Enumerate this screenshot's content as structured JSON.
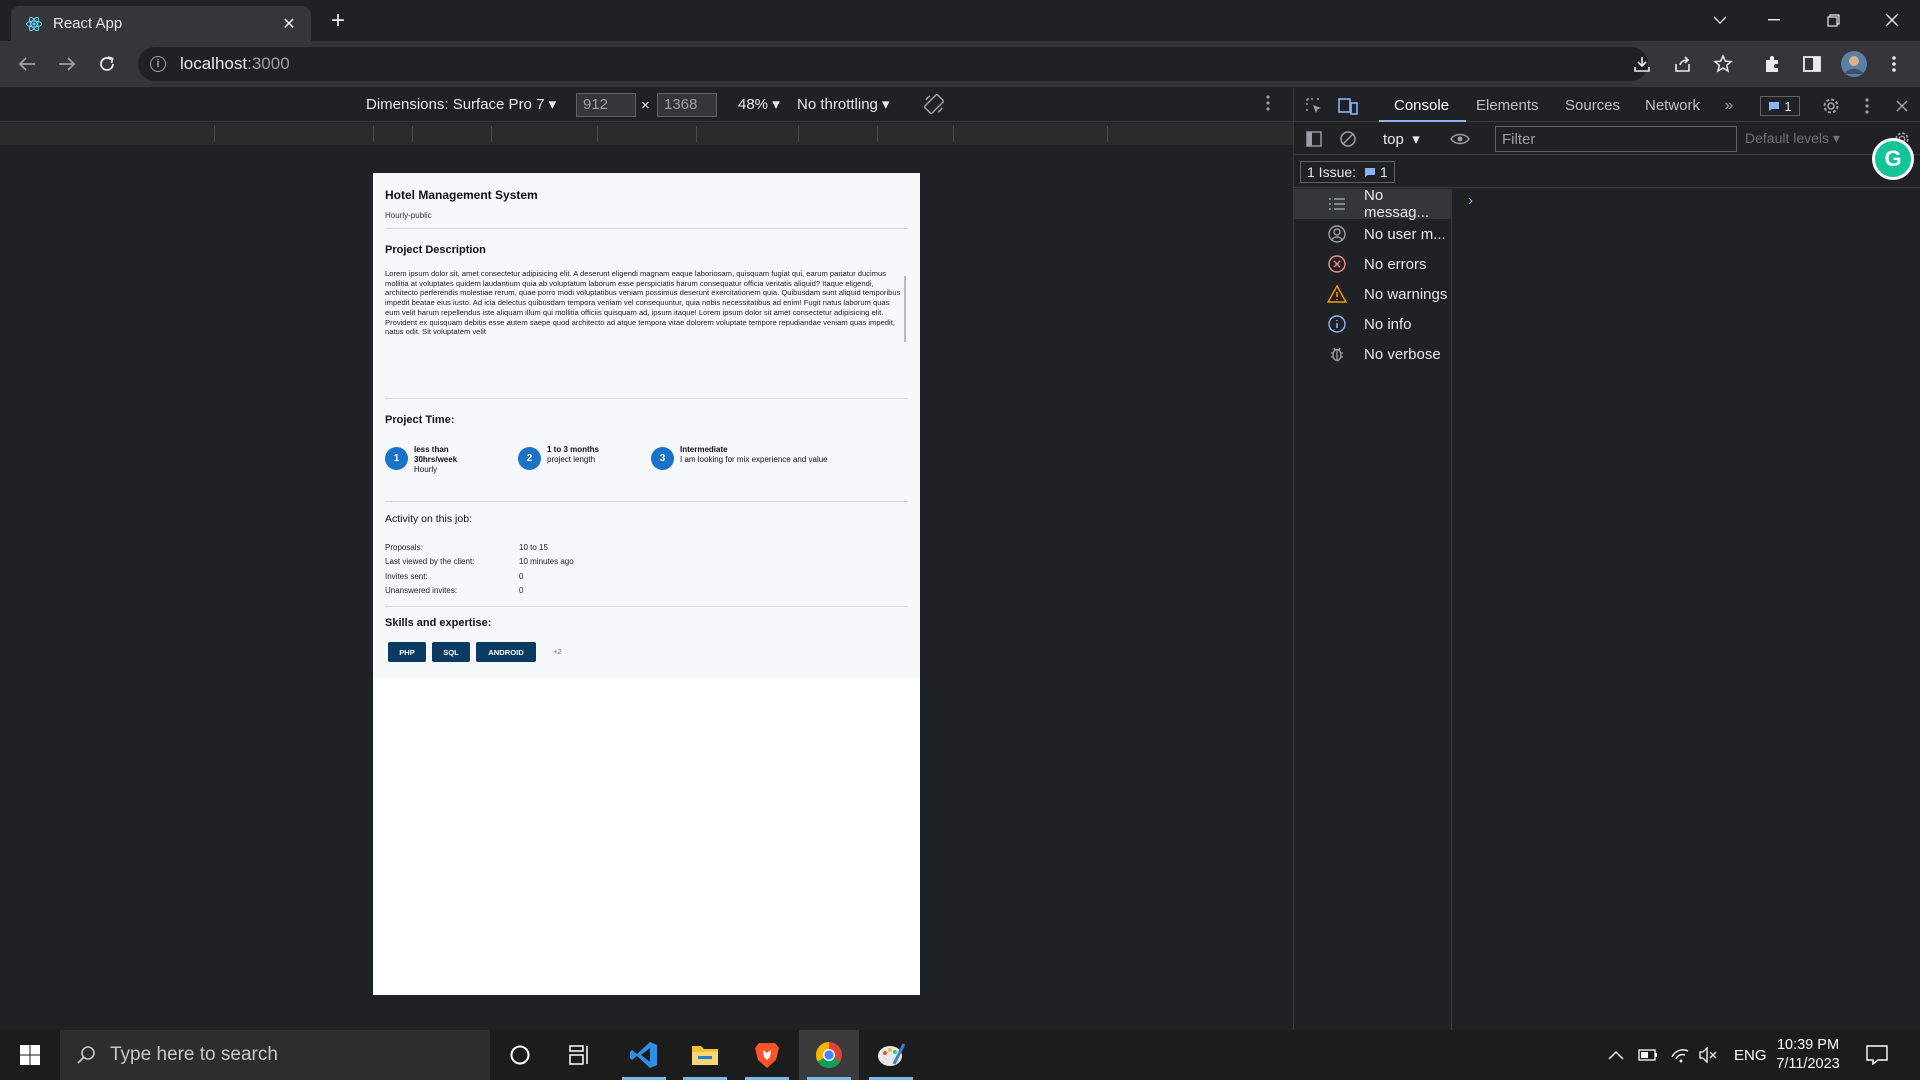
{
  "browser": {
    "tab_title": "React App",
    "url_host": "localhost",
    "url_port": ":3000"
  },
  "device_toolbar": {
    "dimensions_label": "Dimensions: Surface Pro 7",
    "width_value": "912",
    "times": "×",
    "height_value": "1368",
    "zoom": "48%",
    "throttling": "No throttling"
  },
  "page": {
    "title": "Hotel Management System",
    "subtitle": "Hourly-public",
    "description_heading": "Project Description",
    "description": "Lorem ipsum dolor sit, amet consectetur adipisicing elit. A deserunt eligendi magnam eaque laboriosam, quisquam fugiat qui, earum pariatur ducimus mollitia at voluptates quidem laudantium quia ab voluptatum laborum esse perspiciatis harum consequatur officia veritatis aliquid? Itaque eligendi, architecto perferendis molestiae rerum, quae porro modi voluptatibus veniam possimus deserunt exercitationem quia. Quibusdam sunt aliquid temporibus impedit beatae eius iusto. Ad icia delectus quibusdam tempora veniam vel consequuntur, quia nobis necessitatibus ad enim! Fugit natus laborum quas eum velit harum repellendus iste aliquam illum qui mollitia officiis quisquam ad, ipsum itaque! Lorem ipsum dolor sit amet consectetur adipisicing elit. Provident ex quisquam debitis esse autem saepe quod architecto ad atque tempora vitae dolorem voluptate tempore repudiandae veniam quas impedit, natus odit. Sit voluptatem velit",
    "time_heading": "Project Time:",
    "steps": [
      {
        "num": "1",
        "title": "less than 30hrs/week",
        "detail": "Hourly"
      },
      {
        "num": "2",
        "title": "1 to 3 months",
        "detail": "project length"
      },
      {
        "num": "3",
        "title": "Intermediate",
        "detail": "I am looking for mix experience and value"
      }
    ],
    "activity_heading": "Activity on this job:",
    "activity": [
      {
        "label": "Proposals:",
        "value": "10 to 15"
      },
      {
        "label": "Last viewed by the client:",
        "value": "10 minutes ago"
      },
      {
        "label": "Invites sent:",
        "value": "0"
      },
      {
        "label": "Unanswered invites:",
        "value": "0"
      }
    ],
    "skills_heading": "Skills and expertise:",
    "skills": [
      "PHP",
      "SQL",
      "ANDROID"
    ],
    "skills_more": "+2"
  },
  "devtools": {
    "tabs": [
      "Console",
      "Elements",
      "Sources",
      "Network"
    ],
    "issues_badge": "1",
    "context": "top",
    "filter_placeholder": "Filter",
    "levels": "Default levels",
    "issue_label": "1 Issue:",
    "issue_count": "1",
    "sidebar": [
      "No messag...",
      "No user m...",
      "No errors",
      "No warnings",
      "No info",
      "No verbose"
    ]
  },
  "taskbar": {
    "search_placeholder": "Type here to search",
    "lang": "ENG",
    "time": "10:39 PM",
    "date": "7/11/2023"
  },
  "colors": {
    "accent_blue": "#1a73c8",
    "chip_navy": "#0b3a63",
    "error_red": "#f28b82",
    "warning_orange": "#f29900",
    "info_blue": "#8ab4f8"
  }
}
